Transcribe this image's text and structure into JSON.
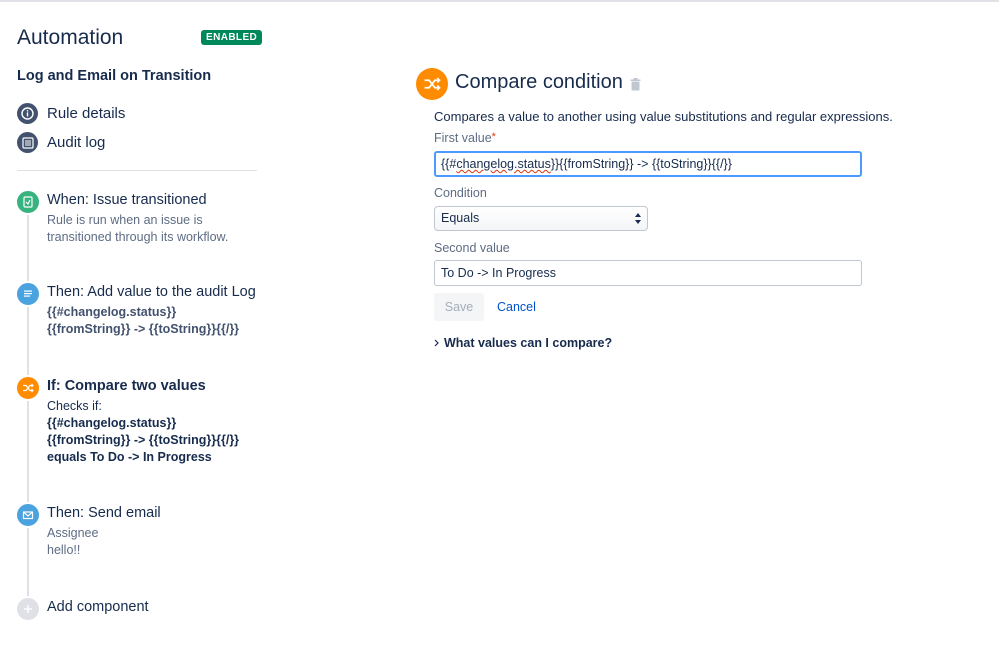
{
  "header": {
    "title": "Automation",
    "status_badge": "ENABLED"
  },
  "rule": {
    "name": "Log and Email on Transition"
  },
  "nav": [
    {
      "label": "Rule details",
      "icon": "info-icon"
    },
    {
      "label": "Audit log",
      "icon": "list-icon"
    }
  ],
  "components": [
    {
      "title": "When: Issue transitioned",
      "desc_lines": [
        "Rule is run when an issue is",
        "transitioned through its workflow."
      ],
      "icon": "transition-icon",
      "color": "#36b37e"
    },
    {
      "title": "Then: Add value to the audit Log",
      "desc_lines": [
        "{{#changelog.status}}",
        "{{fromString}} -> {{toString}}{{/}}"
      ],
      "icon": "log-icon",
      "color": "#4aa3df"
    },
    {
      "title": "If: Compare two values",
      "desc_lines": [
        "Checks if:",
        "{{#changelog.status}}",
        "{{fromString}} -> {{toString}}{{/}}",
        "equals To Do -> In Progress"
      ],
      "icon": "shuffle-icon",
      "color": "#ff8b00"
    },
    {
      "title": "Then: Send email",
      "desc_lines": [
        "Assignee",
        "hello!!"
      ],
      "icon": "email-icon",
      "color": "#4aa3df"
    }
  ],
  "add_component": {
    "label": "Add component"
  },
  "panel": {
    "title": "Compare condition",
    "description": "Compares a value to another using value substitutions and regular expressions.",
    "first_value_label": "First value",
    "required_mark": "*",
    "first_value_parts": [
      "{{#",
      "changelog.status",
      "}}{{fromString}} -> {{toString}}{{/}}"
    ],
    "condition_label": "Condition",
    "condition_selected": "Equals",
    "second_value_label": "Second value",
    "second_value": "To Do -> In Progress",
    "save_label": "Save",
    "cancel_label": "Cancel",
    "help_label": "What values can I compare?"
  },
  "colors": {
    "accent": "#ff8b00",
    "enabled": "#00875a",
    "link": "#0052cc",
    "focus": "#4c9aff"
  }
}
